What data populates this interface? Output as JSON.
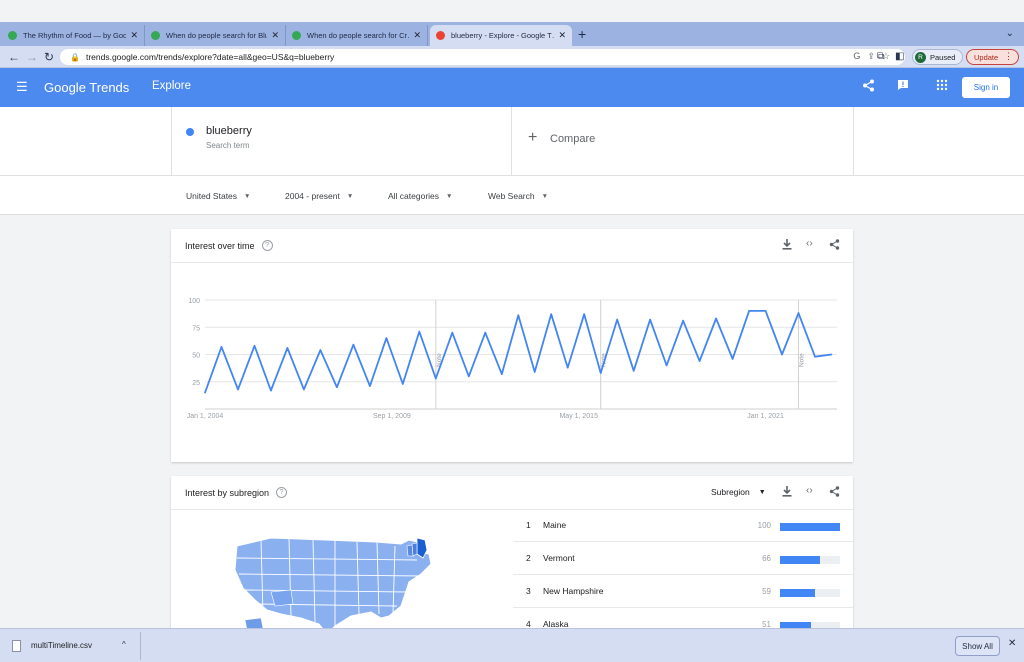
{
  "browser": {
    "tabs": [
      {
        "title": "The Rhythm of Food — by Goo…",
        "favicon_color": "#34a853"
      },
      {
        "title": "When do people search for Blu…",
        "favicon_color": "#34a853"
      },
      {
        "title": "When do people search for Cr…",
        "favicon_color": "#34a853"
      },
      {
        "title": "blueberry - Explore - Google T…",
        "favicon_color": "#ea4335"
      }
    ],
    "url": "trends.google.com/trends/explore?date=all&geo=US&q=blueberry",
    "profile_initial": "R",
    "paused_label": "Paused",
    "update_label": "Update"
  },
  "app": {
    "logo": "Google Trends",
    "section": "Explore",
    "sign_in": "Sign in"
  },
  "search": {
    "term": "blueberry",
    "term_subtitle": "Search term",
    "term_color": "#4285f4",
    "compare_label": "Compare"
  },
  "filters": {
    "region": "United States",
    "period": "2004 - present",
    "category": "All categories",
    "search_type": "Web Search"
  },
  "interest_over_time": {
    "title": "Interest over time",
    "note_label": "Note",
    "chart_data": {
      "type": "line",
      "title": "Interest over time",
      "x_tick_labels": [
        "Jan 1, 2004",
        "Sep 1, 2009",
        "May 1, 2015",
        "Jan 1, 2021"
      ],
      "y_tick_labels": [
        "100",
        "75",
        "50",
        "25"
      ],
      "ylim": [
        0,
        100
      ],
      "grid": true,
      "notes": [
        "Jan 1, 2011",
        "Jan 1, 2016",
        "Jan 1, 2022"
      ],
      "series": [
        {
          "color": "#4285f4",
          "x": [
            "2004-01",
            "2004-07",
            "2005-01",
            "2005-07",
            "2006-01",
            "2006-07",
            "2007-01",
            "2007-07",
            "2008-01",
            "2008-07",
            "2009-01",
            "2009-07",
            "2010-01",
            "2010-07",
            "2011-01",
            "2011-07",
            "2012-01",
            "2012-07",
            "2013-01",
            "2013-07",
            "2014-01",
            "2014-07",
            "2015-01",
            "2015-07",
            "2016-01",
            "2016-07",
            "2017-01",
            "2017-07",
            "2018-01",
            "2018-07",
            "2019-01",
            "2019-07",
            "2020-01",
            "2020-07",
            "2021-01",
            "2021-07",
            "2022-01",
            "2022-07",
            "2023-01"
          ],
          "values": [
            15,
            57,
            18,
            58,
            17,
            56,
            18,
            54,
            20,
            59,
            21,
            65,
            23,
            71,
            28,
            70,
            30,
            70,
            32,
            86,
            34,
            87,
            38,
            87,
            33,
            82,
            35,
            82,
            40,
            81,
            44,
            83,
            46,
            90,
            90,
            50,
            88,
            48,
            50
          ]
        }
      ]
    }
  },
  "interest_by_subregion": {
    "title": "Interest by subregion",
    "dropdown": "Subregion",
    "rows": [
      {
        "rank": "1",
        "name": "Maine",
        "value": 100
      },
      {
        "rank": "2",
        "name": "Vermont",
        "value": 66
      },
      {
        "rank": "3",
        "name": "New Hampshire",
        "value": 59
      },
      {
        "rank": "4",
        "name": "Alaska",
        "value": 51
      }
    ]
  },
  "downloads": {
    "file": "multiTimeline.csv",
    "show_all": "Show All"
  }
}
